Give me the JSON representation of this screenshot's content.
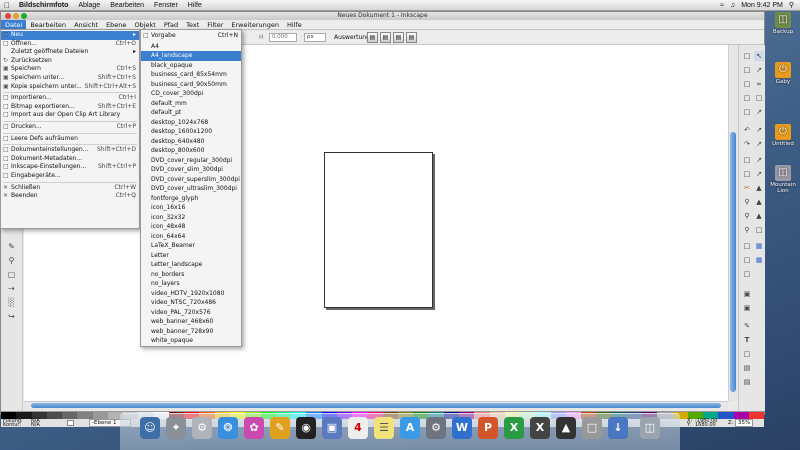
{
  "mac_menubar": {
    "app_name": "Bildschirmfoto",
    "items": [
      "Ablage",
      "Bearbeiten",
      "Fenster",
      "Hilfe"
    ],
    "clock": "Mon 9:42 PM"
  },
  "window": {
    "title": "Neues Dokument 1 - Inkscape",
    "menu": [
      "Datei",
      "Bearbeiten",
      "Ansicht",
      "Ebene",
      "Objekt",
      "Pfad",
      "Text",
      "Filter",
      "Erweiterungen",
      "Hilfe"
    ],
    "toolbar": {
      "h_value": "0,000",
      "unit": "px",
      "auswertung_label": "Auswertung:"
    }
  },
  "file_menu": {
    "items": [
      {
        "label": "Neu",
        "shortcut": "",
        "submenu": true,
        "highlight": true
      },
      {
        "label": "Öffnen...",
        "shortcut": "Ctrl+O"
      },
      {
        "label": "Zuletzt geöffnete Dateien",
        "shortcut": "",
        "submenu": true
      },
      {
        "label": "Zurücksetzen",
        "shortcut": ""
      },
      {
        "label": "Speichern",
        "shortcut": "Ctrl+S"
      },
      {
        "label": "Speichern unter...",
        "shortcut": "Shift+Ctrl+S"
      },
      {
        "label": "Kopie speichern unter...",
        "shortcut": "Shift+Ctrl+Alt+S"
      },
      {
        "sep": true
      },
      {
        "label": "Importieren...",
        "shortcut": "Ctrl+I"
      },
      {
        "label": "Bitmap exportieren...",
        "shortcut": "Shift+Ctrl+E"
      },
      {
        "label": "Import aus der Open Clip Art Library",
        "shortcut": ""
      },
      {
        "sep": true
      },
      {
        "label": "Drucken...",
        "shortcut": "Ctrl+P"
      },
      {
        "sep": true
      },
      {
        "label": "Leere Defs aufräumen",
        "shortcut": ""
      },
      {
        "sep": true
      },
      {
        "label": "Dokumenteinstellungen...",
        "shortcut": "Shift+Ctrl+D"
      },
      {
        "label": "Dokument-Metadaten...",
        "shortcut": ""
      },
      {
        "label": "Inkscape-Einstellungen...",
        "shortcut": "Shift+Ctrl+P"
      },
      {
        "label": "Eingabegeräte...",
        "shortcut": ""
      },
      {
        "sep": true
      },
      {
        "label": "Schließen",
        "shortcut": "Ctrl+W"
      },
      {
        "label": "Beenden",
        "shortcut": "Ctrl+Q"
      }
    ]
  },
  "new_submenu": {
    "first": {
      "label": "Vorgabe",
      "shortcut": "Ctrl+N"
    },
    "items": [
      "A4",
      "A4_landscape",
      "black_opaque",
      "business_card_85x54mm",
      "business_card_90x50mm",
      "CD_cover_300dpi",
      "default_mm",
      "default_pt",
      "desktop_1024x768",
      "desktop_1600x1200",
      "desktop_640x480",
      "desktop_800x600",
      "DVD_cover_regular_300dpi",
      "DVD_cover_slim_300dpi",
      "DVD_cover_superslim_300dpi",
      "DVD_cover_ultraslim_300dpi",
      "fontforge_glyph",
      "icon_16x16",
      "icon_32x32",
      "icon_48x48",
      "icon_64x64",
      "LaTeX_Beamer",
      "Letter",
      "Letter_landscape",
      "no_borders",
      "no_layers",
      "video_HDTV_1920x1080",
      "video_NTSC_720x486",
      "video_PAL_720x576",
      "web_banner_468x60",
      "web_banner_728x90",
      "white_opaque"
    ],
    "highlighted": "A4_landscape"
  },
  "status": {
    "fill_label": "Füllung:",
    "fill_value": "N/A",
    "stroke_label": "Kontur:",
    "stroke_value": "N/A",
    "layer": "-Ebene 1",
    "x_label": "X:",
    "x_value": "-1980.00",
    "y_label": "Y:",
    "y_value": "1680.00",
    "zoom_label": "Z:",
    "zoom_value": "35%"
  },
  "desktop_icons": [
    "Backup",
    "Gaby",
    "Untitled",
    "Mountain Lion"
  ],
  "palette": [
    "#000000",
    "#1a1a1a",
    "#333333",
    "#4d4d4d",
    "#666666",
    "#808080",
    "#999999",
    "#b3b3b3",
    "#cccccc",
    "#e6e6e6",
    "#ffffff",
    "#800000",
    "#ff0000",
    "#ff6600",
    "#ffcc00",
    "#ffff00",
    "#80ff00",
    "#00ff00",
    "#00ff80",
    "#00ffff",
    "#0080ff",
    "#0000ff",
    "#8000ff",
    "#ff00ff",
    "#ff0080",
    "#804000",
    "#808000",
    "#008000",
    "#008080",
    "#000080",
    "#800080",
    "#ff8080",
    "#ffcc99",
    "#ffff99",
    "#ccffcc",
    "#99ffff",
    "#9999ff",
    "#ff99ff",
    "#c04000",
    "#406000",
    "#006060",
    "#204080",
    "#600060",
    "#a0a0a0",
    "#d4aa00",
    "#55aa00",
    "#00aa88",
    "#2255cc",
    "#aa00aa",
    "#ee3333"
  ]
}
